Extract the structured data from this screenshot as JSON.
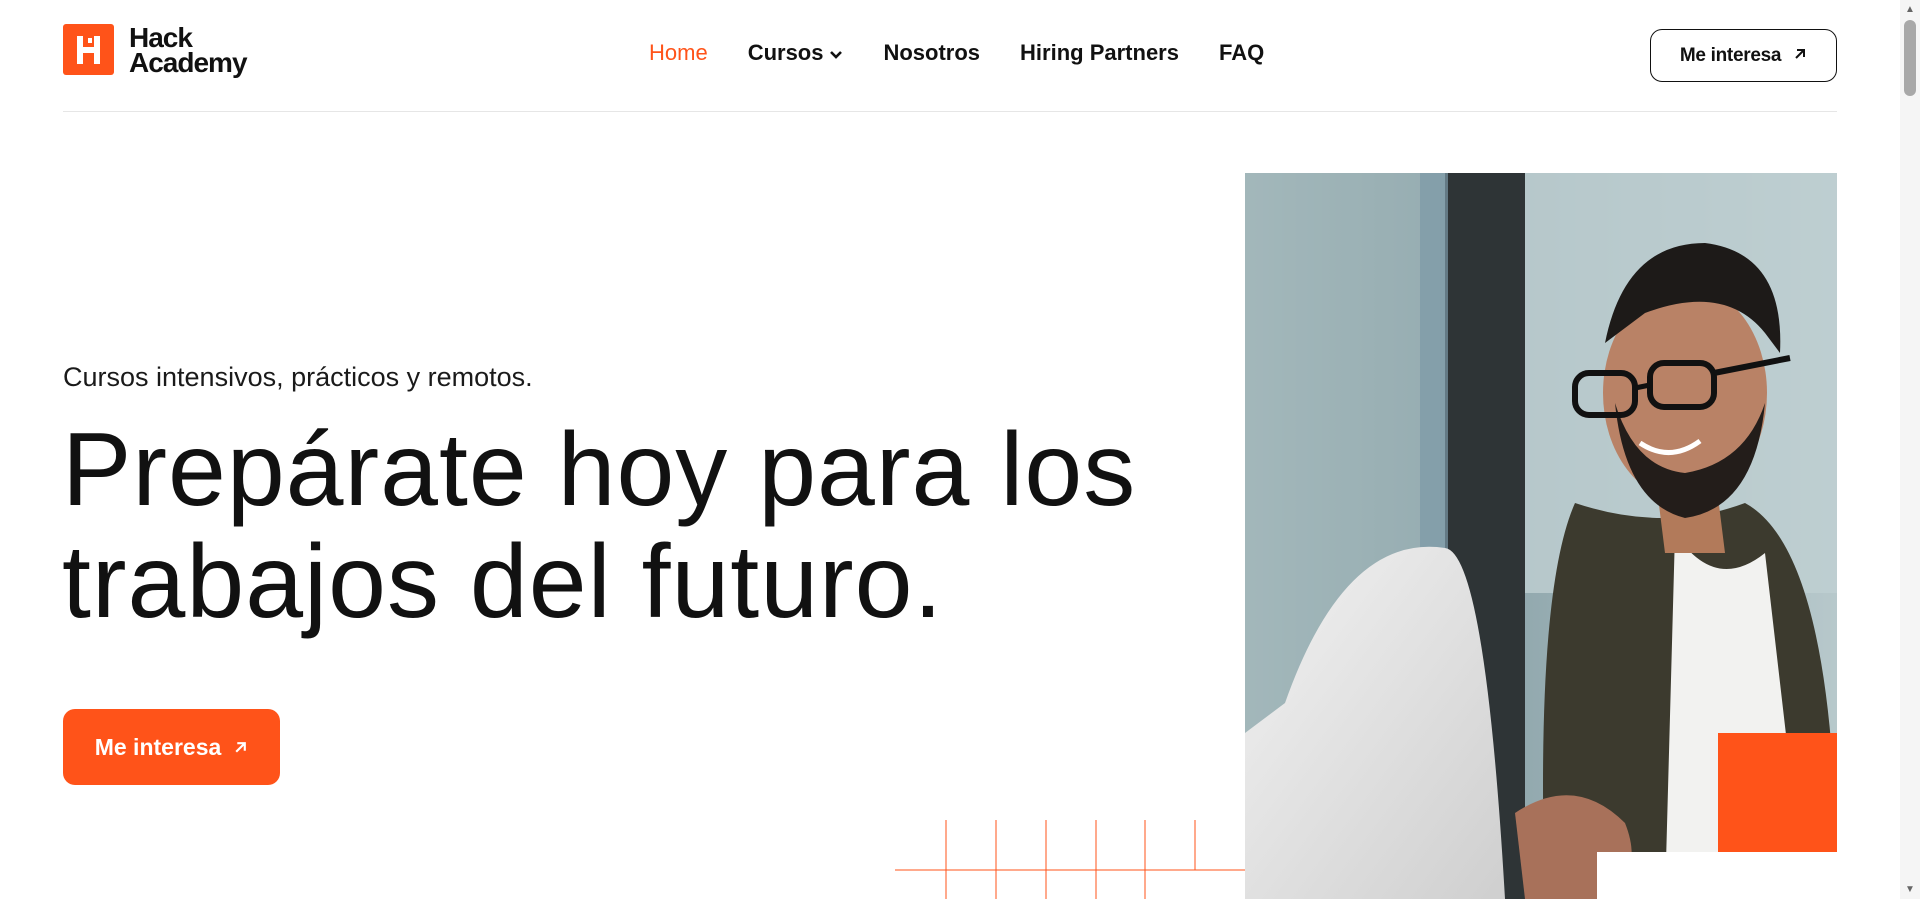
{
  "brand": {
    "line1": "Hack",
    "line2": "Academy",
    "accent": "#ff5319"
  },
  "nav": {
    "items": [
      {
        "label": "Home",
        "active": true
      },
      {
        "label": "Cursos",
        "has_dropdown": true
      },
      {
        "label": "Nosotros"
      },
      {
        "label": "Hiring Partners"
      },
      {
        "label": "FAQ"
      }
    ]
  },
  "header_cta": {
    "label": "Me interesa",
    "icon": "arrow-up-right-icon"
  },
  "hero": {
    "kicker": "Cursos intensivos, prácticos y remotos.",
    "headline_line1": "Prepárate hoy para los",
    "headline_line2": "trabajos del futuro.",
    "cta_label": "Me interesa",
    "cta_icon": "arrow-up-right-icon"
  }
}
